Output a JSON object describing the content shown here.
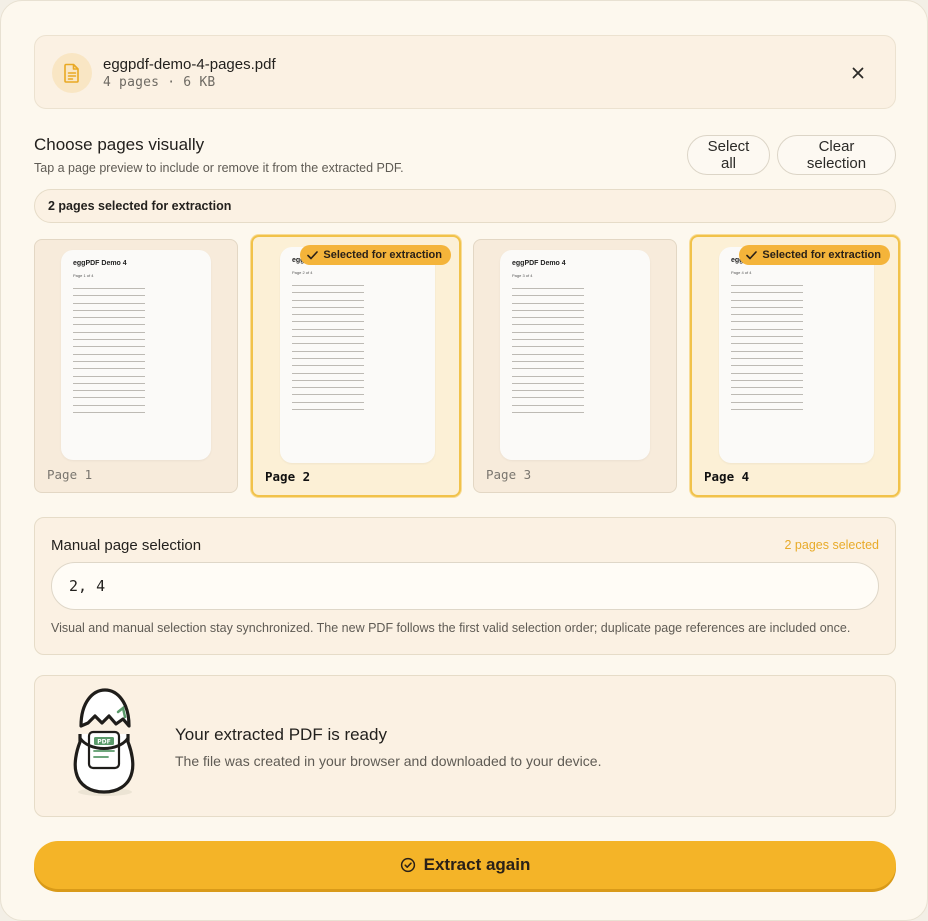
{
  "colors": {
    "accent": "#f4b428",
    "badge": "#f4b43a",
    "panel": "#fbf1e3",
    "background": "#fdf8ee"
  },
  "file": {
    "name": "eggpdf-demo-4-pages.pdf",
    "meta": "4 pages · 6 KB",
    "icon": "document-icon",
    "close_icon": "close-icon"
  },
  "visual": {
    "title": "Choose pages visually",
    "subtitle": "Tap a page preview to include or remove it from the extracted PDF.",
    "select_all_label": "Select all",
    "clear_label": "Clear selection",
    "selection_summary": "2 pages selected for extraction",
    "badge_label": "Selected for extraction",
    "pages": [
      {
        "label": "Page 1",
        "doc_title": "eggPDF Demo 4",
        "doc_sub": "Page 1 of 4",
        "selected": false
      },
      {
        "label": "Page 2",
        "doc_title": "eggPDF Demo 4",
        "doc_sub": "Page 2 of 4",
        "selected": true
      },
      {
        "label": "Page 3",
        "doc_title": "eggPDF Demo 4",
        "doc_sub": "Page 3 of 4",
        "selected": false
      },
      {
        "label": "Page 4",
        "doc_title": "eggPDF Demo 4",
        "doc_sub": "Page 4 of 4",
        "selected": true
      }
    ]
  },
  "manual": {
    "title": "Manual page selection",
    "count": "2 pages selected",
    "value": "2, 4",
    "help": "Visual and manual selection stay synchronized. The new PDF follows the first valid selection order; duplicate page references are included once."
  },
  "result": {
    "title": "Your extracted PDF is ready",
    "subtitle": "The file was created in your browser and downloaded to your device.",
    "illustration": "egg-pdf-icon",
    "illustration_label": "PDF"
  },
  "action": {
    "label": "Extract again",
    "icon": "check-circle-icon"
  }
}
